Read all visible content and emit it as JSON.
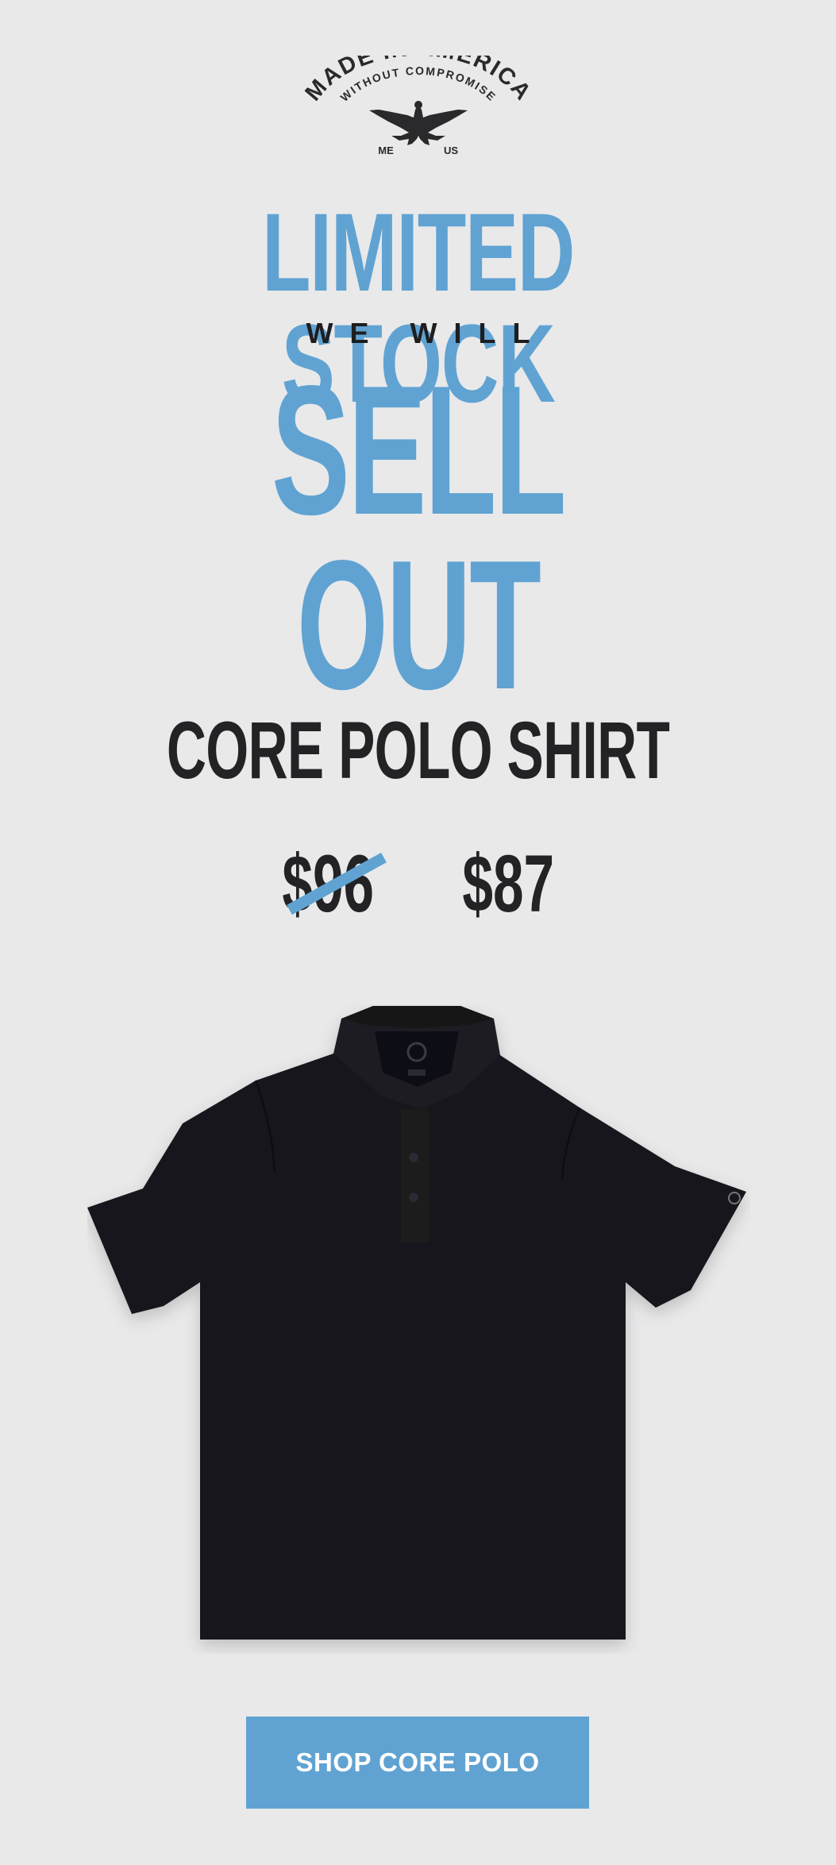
{
  "badge": {
    "top_arc_text": "MADE IN AMERICA",
    "inner_arc_text": "WITHOUT COMPROMISE",
    "left_tag": "ME",
    "right_tag": "US",
    "icon": "eagle-icon"
  },
  "headline": {
    "line1": "LIMITED STOCK",
    "line2": "WE WILL",
    "line3": "SELL OUT"
  },
  "product": {
    "name": "CORE POLO SHIRT",
    "price_original": "$96",
    "price_sale": "$87",
    "image_icon": "polo-shirt-image"
  },
  "cta": {
    "label": "SHOP CORE POLO"
  },
  "colors": {
    "accent": "#60a3d2",
    "text": "#232325",
    "background": "#e9e9ea",
    "shirt": "#17171b"
  }
}
